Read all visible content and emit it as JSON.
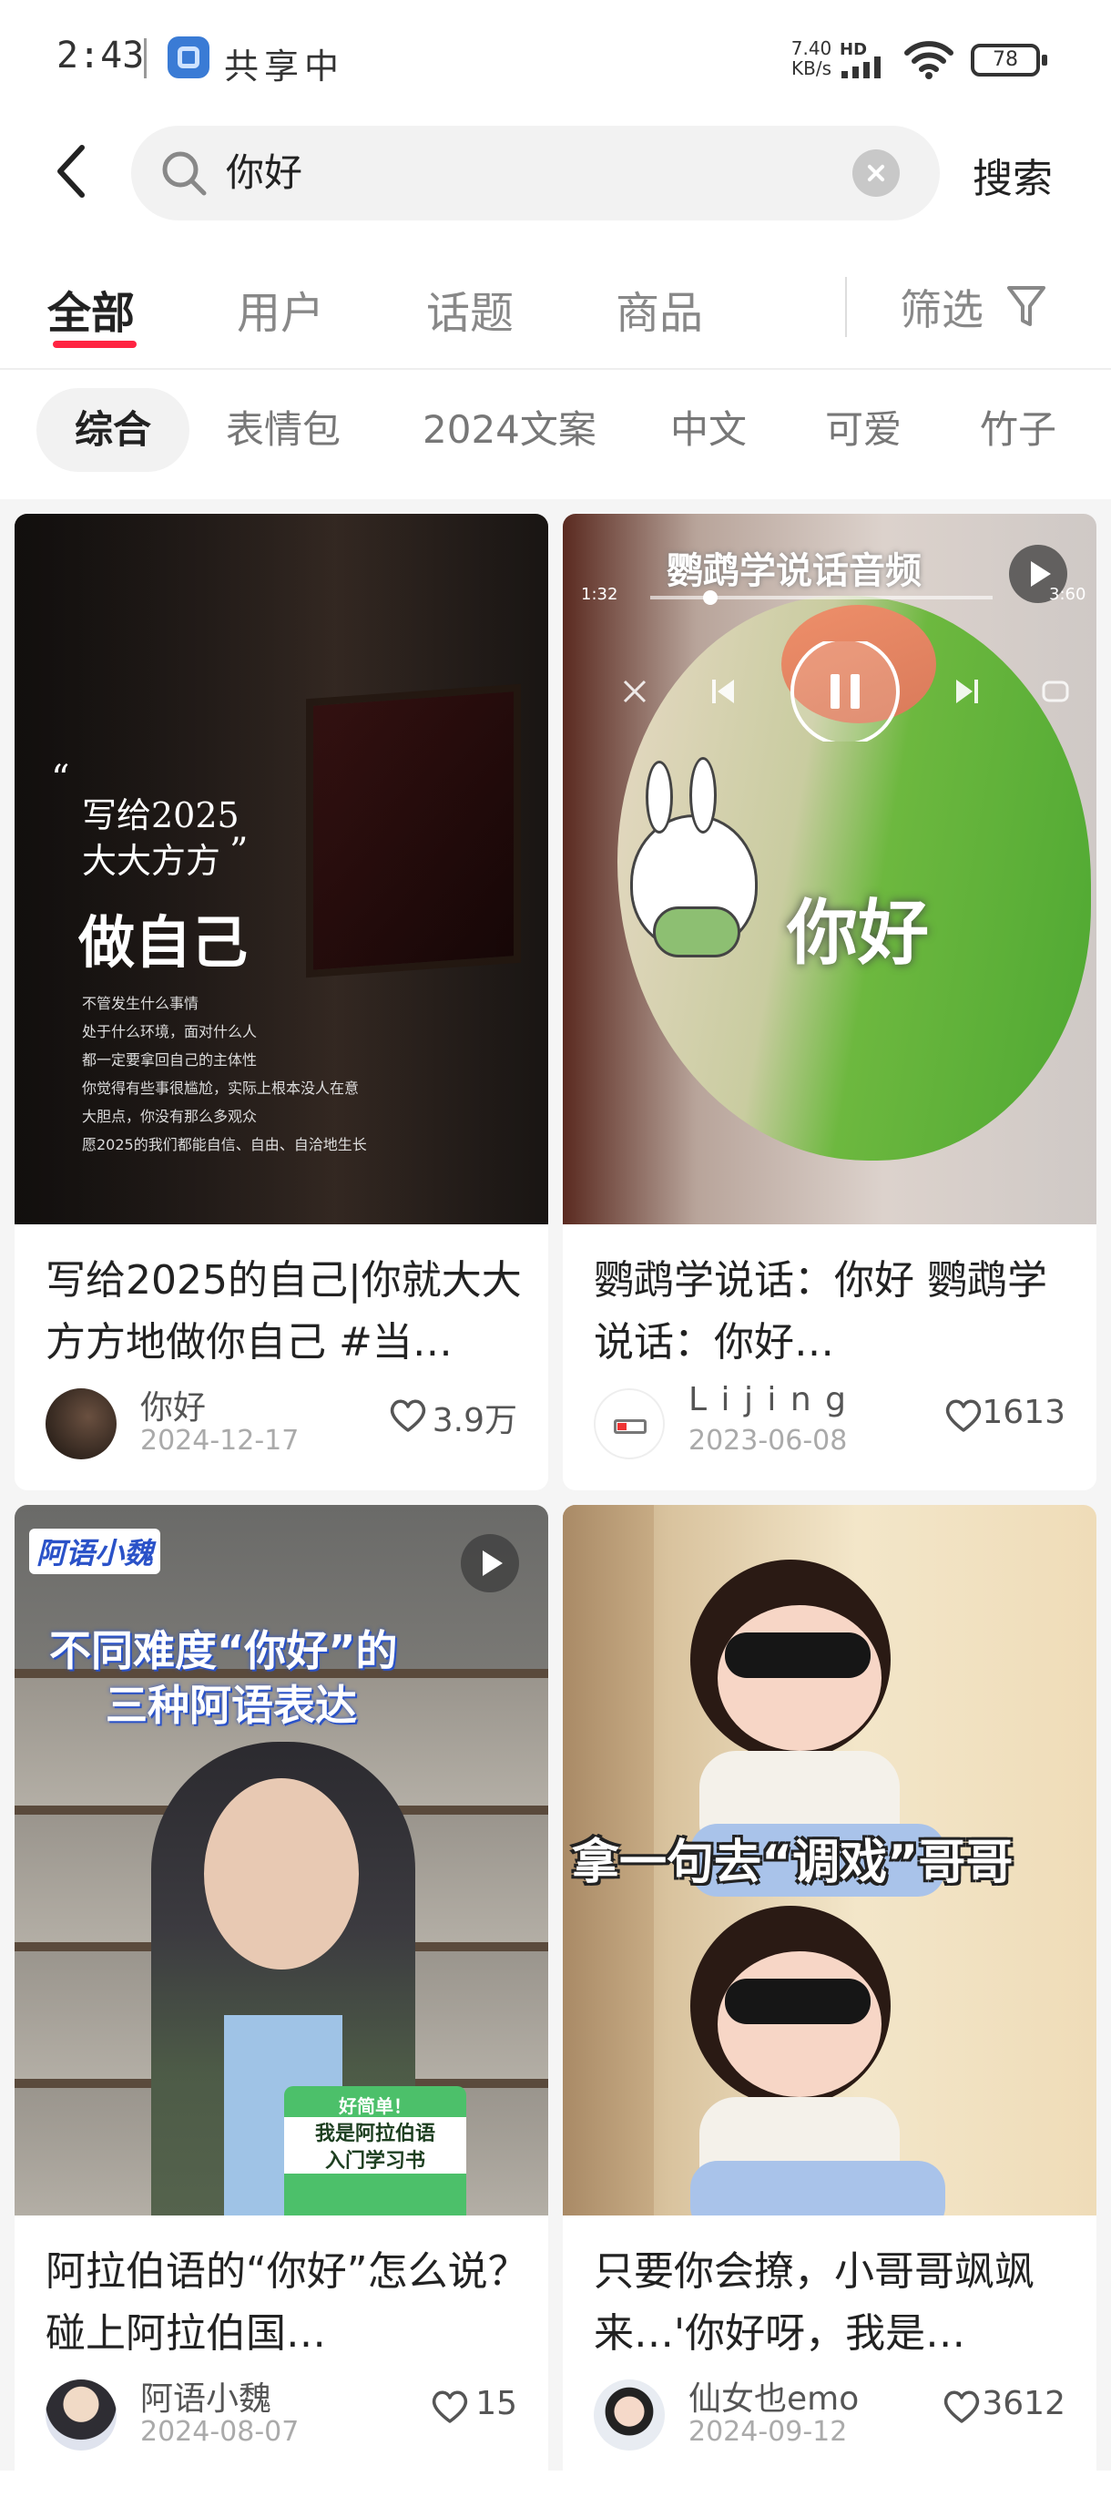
{
  "status": {
    "time": "2:43",
    "sharing": "共享中",
    "net_speed_value": "7.40",
    "net_speed_unit": "KB/s",
    "network": "HD",
    "battery": "78"
  },
  "search": {
    "query": "你好",
    "button_label": "搜索"
  },
  "tabs": [
    {
      "label": "全部"
    },
    {
      "label": "用户"
    },
    {
      "label": "话题"
    },
    {
      "label": "商品"
    }
  ],
  "filter_label": "筛选",
  "chips": [
    {
      "label": "综合"
    },
    {
      "label": "表情包"
    },
    {
      "label": "2024文案"
    },
    {
      "label": "中文"
    },
    {
      "label": "可爱"
    },
    {
      "label": "竹子"
    }
  ],
  "cards": [
    {
      "title": "写给2025的自己|你就大大方方地做你自己 #当…",
      "author": "你好",
      "date": "2024-12-17",
      "likes": "3.9万",
      "thumb": {
        "quote_line1": "写给2025",
        "quote_line2": "大大方方",
        "headline": "做自己",
        "body": [
          "不管发生什么事情",
          "处于什么环境，面对什么人",
          "都一定要拿回自己的主体性",
          "你觉得有些事很尴尬，实际上根本没人在意",
          "大胆点，你没有那么多观众",
          "愿2025的我们都能自信、自由、自洽地生长"
        ]
      }
    },
    {
      "title": "鹦鹉学说话：你好 鹦鹉学说话：你好…",
      "author": "L i j i n g",
      "date": "2023-06-08",
      "likes": "1613",
      "thumb": {
        "caption": "鹦鹉学说话音频",
        "time_start": "1:32",
        "time_end": "3:60",
        "big_text": "你好"
      }
    },
    {
      "title": "阿拉伯语的“你好”怎么说？碰上阿拉伯国…",
      "author": "阿语小魏",
      "date": "2024-08-07",
      "likes": "15",
      "thumb": {
        "brand": "阿语小魏",
        "headline_line1": "不同难度“你好”的",
        "headline_line2": "三种阿语表达",
        "book_top": "好简单！",
        "book_line1": "我是阿拉伯语",
        "book_line2": "入门学习书"
      }
    },
    {
      "title": "只要你会撩，小哥哥飒飒来…'你好呀，我是…",
      "author": "仙女也emo",
      "date": "2024-09-12",
      "likes": "3612",
      "thumb": {
        "caption": "拿一句去“调戏”哥哥"
      }
    }
  ],
  "colors": {
    "accent": "#ff2442",
    "feed_bg": "#f5f5f5"
  }
}
